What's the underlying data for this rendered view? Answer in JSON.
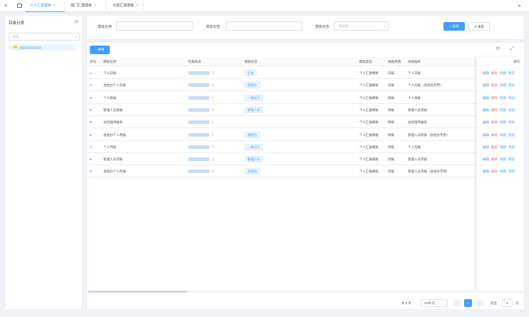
{
  "tabs": {
    "nav_left": "«",
    "home_icon": "home-icon",
    "nav_right": "»",
    "items": [
      {
        "label": "个人汇报模板",
        "active": true
      },
      {
        "label": "部门汇报模板",
        "active": false
      },
      {
        "label": "日报汇报模板",
        "active": false
      }
    ],
    "close_glyph": "×"
  },
  "sidebar": {
    "title": "目录分类",
    "refresh_glyph": "⟳",
    "search_placeholder": "搜索",
    "search_glyph": "⌕"
  },
  "filter": {
    "name_label": "模板名称",
    "tag_label": "模板标签",
    "status_label": "模板状态",
    "status_placeholder": "请选择",
    "dropdown_glyph": "⌄",
    "search_button": "查询",
    "reset_button": "重置"
  },
  "toolbar": {
    "add_button": "+ 新增",
    "icons": "⟳ ⤢"
  },
  "table": {
    "headers": [
      "序号",
      "模板名称",
      "所属目录",
      "模板标签",
      "模板类型",
      "填报周期",
      "关联报表",
      "操作"
    ],
    "rows": [
      {
        "no": "1",
        "name": "个人日报",
        "tags": [
          "全员"
        ],
        "type": "个人汇报模板",
        "cycle": "日报",
        "report": "个人日报"
      },
      {
        "no": "2",
        "name": "总经办个人日报",
        "tags": [
          "总经办"
        ],
        "type": "个人汇报模板",
        "cycle": "日报",
        "report": "个人日报（总经办专用）"
      },
      {
        "no": "3",
        "name": "个人周报",
        "tags": [
          "一般员工"
        ],
        "type": "个人汇报模板",
        "cycle": "周报",
        "report": "个人周报"
      },
      {
        "no": "4",
        "name": "管理人员周报",
        "tags": [
          "管理人员"
        ],
        "type": "个人汇报模板",
        "cycle": "周报",
        "report": "管理人员周报"
      },
      {
        "no": "5",
        "name": "总经理周报表",
        "tags": [],
        "type": "个人汇报模板",
        "cycle": "周报",
        "report": "总经理周报表"
      },
      {
        "no": "6",
        "name": "总经办个人周报",
        "tags": [
          "总经办"
        ],
        "type": "个人汇报模板",
        "cycle": "周报",
        "report": "管理人员周报（总经办专用）"
      },
      {
        "no": "7",
        "name": "个人月报",
        "tags": [
          "一般员工"
        ],
        "type": "个人汇报模板",
        "cycle": "月报",
        "report": "个人月报"
      },
      {
        "no": "8",
        "name": "管理人员月报",
        "tags": [
          "管理人员"
        ],
        "type": "个人汇报模板",
        "cycle": "月报",
        "report": "管理人员月报"
      },
      {
        "no": "9",
        "name": "总经办个人月报",
        "tags": [
          "总经办"
        ],
        "type": "个人汇报模板",
        "cycle": "月报",
        "report": "管理人员月报（总经办专用）"
      }
    ],
    "ops": [
      "编辑",
      "删除",
      "构建",
      "预览"
    ]
  },
  "pager": {
    "total": "共 9 条",
    "page_size": "20条/页",
    "prev": "‹",
    "current": "1",
    "next": "›",
    "goto_label": "前往",
    "goto_value": "1",
    "page_unit": "页"
  },
  "colors": {
    "primary": "#409eff",
    "danger": "#f56c6c"
  }
}
